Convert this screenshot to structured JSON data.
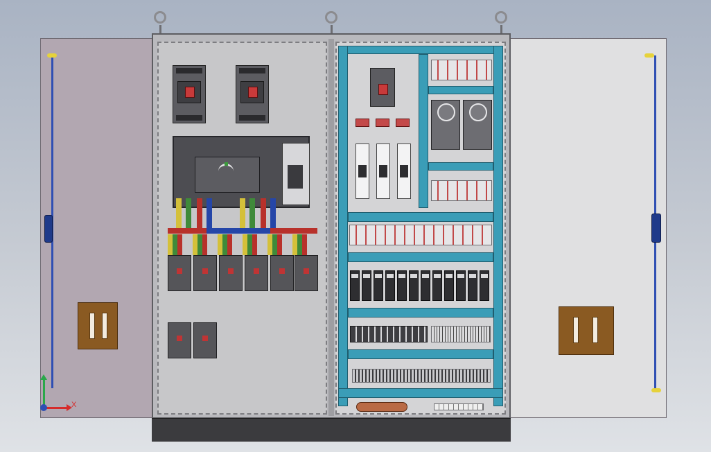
{
  "viewport": {
    "triad": {
      "x_label": "X",
      "colors": {
        "x_axis": "#d62b2b",
        "y_axis": "#2aa84a",
        "origin": "#2f4fb3"
      }
    }
  },
  "cabinet": {
    "colors": {
      "teal_channel": "#3a9db7",
      "breaker_red": "#c83a3a",
      "door_handle": "#8a5a22",
      "bus_red": "#b8312b",
      "bus_blue": "#2546a8",
      "bus_yellow": "#d4c03a",
      "bus_green": "#3f8a3a"
    },
    "left_panel": {
      "main_breakers": 2,
      "ats_units": 1,
      "feeder_breakers": 6,
      "spare_breakers": 2
    },
    "right_panel": {
      "psu_units": 2,
      "fuse_holders": 3,
      "pilot_lamps": 3,
      "relays": 12
    }
  }
}
